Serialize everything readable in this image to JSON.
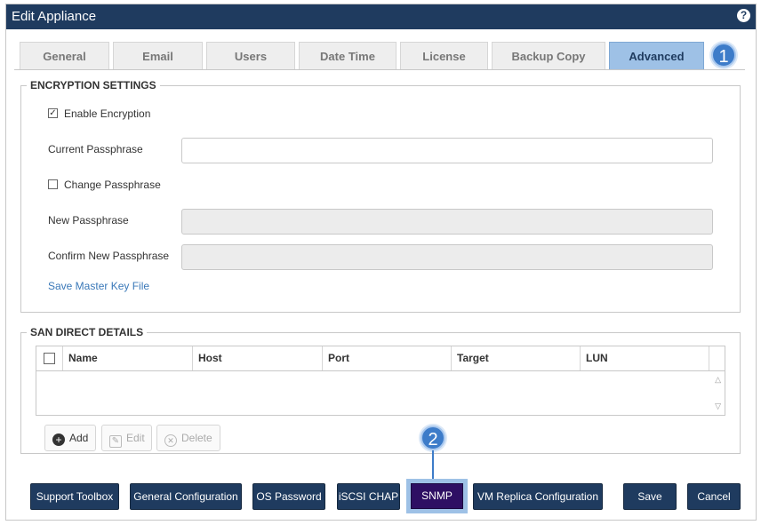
{
  "window": {
    "title": "Edit Appliance",
    "help_icon": "?"
  },
  "tabs": [
    {
      "label": "General"
    },
    {
      "label": "Email"
    },
    {
      "label": "Users"
    },
    {
      "label": "Date Time"
    },
    {
      "label": "License"
    },
    {
      "label": "Backup Copy"
    },
    {
      "label": "Advanced",
      "active": true
    }
  ],
  "callouts": {
    "one": "1",
    "two": "2"
  },
  "encryption": {
    "legend": "ENCRYPTION SETTINGS",
    "enable_label": "Enable Encryption",
    "enable_checked": true,
    "enable_check_glyph": "✓",
    "current_passphrase_label": "Current Passphrase",
    "change_passphrase_label": "Change Passphrase",
    "change_checked": false,
    "new_passphrase_label": "New Passphrase",
    "confirm_passphrase_label": "Confirm New Passphrase",
    "save_key_link": "Save Master Key File"
  },
  "san": {
    "legend": "SAN DIRECT DETAILS",
    "columns": [
      "Name",
      "Host",
      "Port",
      "Target",
      "LUN"
    ],
    "rows": [],
    "add_label": "Add",
    "edit_label": "Edit",
    "delete_label": "Delete"
  },
  "footer": {
    "support_toolbox": "Support Toolbox",
    "general_configuration": "General Configuration",
    "os_password": "OS Password",
    "iscsi_chap": "iSCSI CHAP",
    "snmp": "SNMP",
    "vm_replica": "VM Replica Configuration",
    "save": "Save",
    "cancel": "Cancel"
  },
  "colors": {
    "title_bar": "#1f3b5f",
    "active_tab": "#9ec1e6",
    "callout": "#3d7cc9",
    "snmp_button": "#2e0f63",
    "link": "#3a78b8"
  }
}
